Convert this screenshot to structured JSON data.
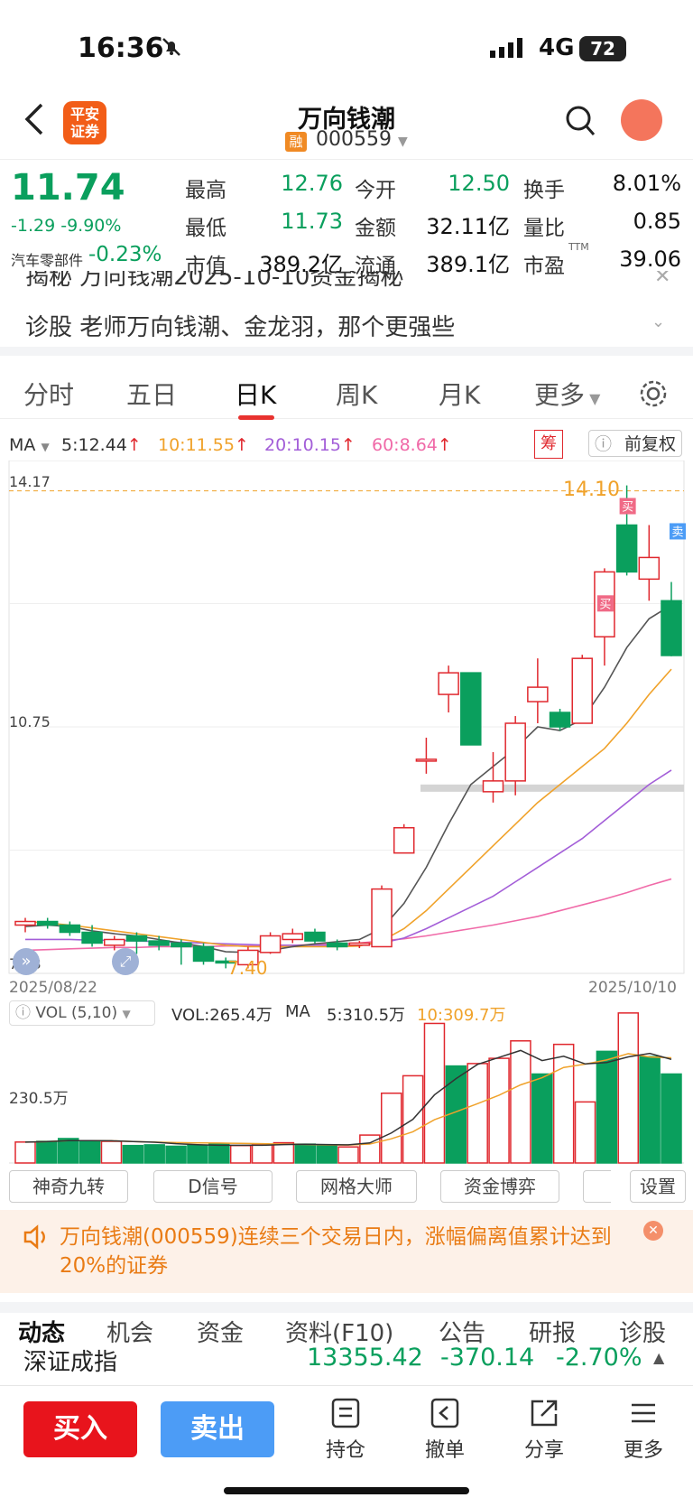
{
  "status": {
    "time": "16:36",
    "network": "4G",
    "battery": "72"
  },
  "header": {
    "title": "万向钱潮",
    "badge": "融",
    "code": "000559",
    "logo_line1": "平安",
    "logo_line2": "证券"
  },
  "quote": {
    "price": "11.74",
    "change": "-1.29",
    "change_pct": "-9.90%",
    "sector_name": "汽车零部件",
    "sector_pct": "-0.23%",
    "high_label": "最高",
    "high": "12.76",
    "open_label": "今开",
    "open": "12.50",
    "turnover_label": "换手",
    "turnover": "8.01%",
    "low_label": "最低",
    "low": "11.73",
    "amount_label": "金额",
    "amount": "32.11亿",
    "vr_label": "量比",
    "vr": "0.85",
    "mcap_label": "市值",
    "mcap": "389.2亿",
    "float_label": "流通",
    "float": "389.1亿",
    "pe_label": "市盈",
    "pe_sup": "TTM",
    "pe": "39.06"
  },
  "news": {
    "line1": "揭秘  万向钱潮2025-10-10资金揭秘",
    "line2": "诊股  老师万向钱潮、金龙羽，那个更强些"
  },
  "tabs": [
    "分时",
    "五日",
    "日K",
    "周K",
    "月K",
    "更多"
  ],
  "ma": {
    "label": "MA",
    "ma5": "5:12.44",
    "ma10": "10:11.55",
    "ma20": "20:10.15",
    "ma60": "60:8.64",
    "chip": "筹",
    "adjust": "前复权"
  },
  "chart_data": {
    "type": "candlestick",
    "y_top_label": "14.17",
    "y_mid_label": "10.75",
    "y_bottom_label": "7.33",
    "max_label": "14.10",
    "min_label": "7.40",
    "start_date": "2025/08/22",
    "end_date": "2025/10/10",
    "candles": [
      {
        "o": 8.0,
        "c": 8.05,
        "h": 8.1,
        "l": 7.9
      },
      {
        "o": 8.05,
        "c": 8.0,
        "h": 8.1,
        "l": 7.95
      },
      {
        "o": 8.0,
        "c": 7.9,
        "h": 8.05,
        "l": 7.85
      },
      {
        "o": 7.9,
        "c": 7.75,
        "h": 8.0,
        "l": 7.7
      },
      {
        "o": 7.72,
        "c": 7.8,
        "h": 7.85,
        "l": 7.65
      },
      {
        "o": 7.85,
        "c": 7.78,
        "h": 7.9,
        "l": 7.6
      },
      {
        "o": 7.78,
        "c": 7.72,
        "h": 7.85,
        "l": 7.65
      },
      {
        "o": 7.75,
        "c": 7.7,
        "h": 7.8,
        "l": 7.45
      },
      {
        "o": 7.7,
        "c": 7.5,
        "h": 7.75,
        "l": 7.45
      },
      {
        "o": 7.5,
        "c": 7.48,
        "h": 7.55,
        "l": 7.4
      },
      {
        "o": 7.45,
        "c": 7.65,
        "h": 7.7,
        "l": 7.4
      },
      {
        "o": 7.62,
        "c": 7.85,
        "h": 7.9,
        "l": 7.6
      },
      {
        "o": 7.8,
        "c": 7.88,
        "h": 7.95,
        "l": 7.75
      },
      {
        "o": 7.9,
        "c": 7.78,
        "h": 7.95,
        "l": 7.75
      },
      {
        "o": 7.75,
        "c": 7.7,
        "h": 7.8,
        "l": 7.65
      },
      {
        "o": 7.72,
        "c": 7.75,
        "h": 7.78,
        "l": 7.68
      },
      {
        "o": 7.7,
        "c": 8.5,
        "h": 8.55,
        "l": 7.7
      },
      {
        "o": 9.0,
        "c": 9.35,
        "h": 9.4,
        "l": 9.0
      },
      {
        "o": 10.3,
        "c": 10.3,
        "h": 10.6,
        "l": 10.1
      },
      {
        "o": 11.2,
        "c": 11.5,
        "h": 11.6,
        "l": 10.95
      },
      {
        "o": 11.5,
        "c": 10.5,
        "h": 11.5,
        "l": 10.5
      },
      {
        "o": 9.85,
        "c": 10.0,
        "h": 10.4,
        "l": 9.7
      },
      {
        "o": 10.0,
        "c": 10.8,
        "h": 10.9,
        "l": 9.8
      },
      {
        "o": 11.1,
        "c": 11.3,
        "h": 11.7,
        "l": 10.8
      },
      {
        "o": 10.95,
        "c": 10.75,
        "h": 11.0,
        "l": 10.7
      },
      {
        "o": 10.8,
        "c": 11.7,
        "h": 11.75,
        "l": 10.8
      },
      {
        "o": 12.0,
        "c": 12.9,
        "h": 12.95,
        "l": 11.6
      },
      {
        "o": 13.55,
        "c": 12.9,
        "h": 14.1,
        "l": 12.85
      },
      {
        "o": 12.8,
        "c": 13.1,
        "h": 13.55,
        "l": 12.5
      },
      {
        "o": 12.5,
        "c": 11.74,
        "h": 12.76,
        "l": 11.73
      }
    ],
    "ma5": [
      7.98,
      8.0,
      7.98,
      7.92,
      7.88,
      7.85,
      7.8,
      7.75,
      7.7,
      7.63,
      7.62,
      7.65,
      7.7,
      7.74,
      7.77,
      7.8,
      7.95,
      8.3,
      8.8,
      9.4,
      9.95,
      10.2,
      10.45,
      10.75,
      10.7,
      10.85,
      11.3,
      11.85,
      12.25,
      12.44
    ],
    "ma10": [
      8.05,
      8.03,
      8.0,
      7.96,
      7.92,
      7.88,
      7.84,
      7.8,
      7.76,
      7.72,
      7.7,
      7.7,
      7.7,
      7.7,
      7.7,
      7.71,
      7.78,
      7.95,
      8.2,
      8.5,
      8.8,
      9.1,
      9.4,
      9.7,
      9.95,
      10.2,
      10.45,
      10.8,
      11.2,
      11.55
    ],
    "ma20": [
      7.8,
      7.8,
      7.8,
      7.79,
      7.79,
      7.78,
      7.77,
      7.76,
      7.75,
      7.74,
      7.73,
      7.72,
      7.72,
      7.72,
      7.72,
      7.72,
      7.75,
      7.82,
      7.95,
      8.1,
      8.25,
      8.4,
      8.6,
      8.8,
      9.0,
      9.2,
      9.45,
      9.7,
      9.95,
      10.15
    ],
    "ma60": [
      7.65,
      7.66,
      7.67,
      7.68,
      7.69,
      7.69,
      7.7,
      7.7,
      7.7,
      7.71,
      7.71,
      7.72,
      7.72,
      7.73,
      7.74,
      7.75,
      7.78,
      7.81,
      7.85,
      7.9,
      7.95,
      8.0,
      8.06,
      8.12,
      8.2,
      8.28,
      8.36,
      8.45,
      8.55,
      8.64
    ],
    "signals": [
      "买",
      "买",
      "卖"
    ],
    "vol_label": "VOL (5,10)",
    "vol_value": "VOL:265.4万",
    "vol_ma": "MA",
    "vol_ma5": "5:310.5万",
    "vol_ma10": "10:309.7万",
    "vol_axis": "230.5万",
    "volumes": [
      60,
      62,
      70,
      64,
      62,
      50,
      52,
      48,
      50,
      54,
      50,
      52,
      58,
      54,
      50,
      46,
      80,
      200,
      250,
      400,
      278,
      285,
      300,
      350,
      255,
      340,
      175,
      320,
      430,
      305,
      255
    ]
  },
  "indicators": [
    "神奇九转",
    "D信号",
    "网格大师",
    "资金博弈",
    "设置"
  ],
  "alert": "万向钱潮(000559)连续三个交易日内，涨幅偏离值累计达到20%的证券",
  "subtabs": [
    "动态",
    "机会",
    "资金",
    "资料(F10)",
    "公告",
    "研报",
    "诊股"
  ],
  "index": {
    "name": "深证成指",
    "value": "13355.42",
    "change": "-370.14",
    "pct": "-2.70%"
  },
  "bottom": {
    "buy": "买入",
    "sell": "卖出",
    "hold": "持仓",
    "cancel": "撤单",
    "share": "分享",
    "more": "更多"
  }
}
